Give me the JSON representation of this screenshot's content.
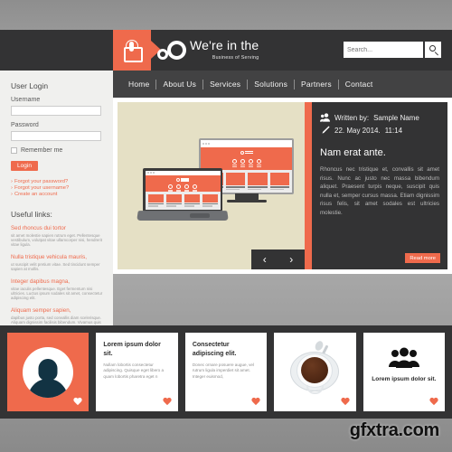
{
  "header": {
    "brand_line1": "We're in the",
    "brand_line2": "Business of Serving",
    "search_placeholder": "Search...",
    "search_value": ""
  },
  "nav": {
    "items": [
      {
        "label": "Home"
      },
      {
        "label": "About Us"
      },
      {
        "label": "Services"
      },
      {
        "label": "Solutions"
      },
      {
        "label": "Partners"
      },
      {
        "label": "Contact"
      }
    ]
  },
  "sidebar": {
    "login_title": "User Login",
    "username_label": "Username",
    "username_value": "",
    "password_label": "Password",
    "password_value": "",
    "remember_label": "Remember me",
    "login_button": "Login",
    "forgot_password": "Forgot your password?",
    "forgot_username": "Forgot your username?",
    "create_account": "Create an account",
    "useful_links_title": "Useful links:",
    "links": [
      {
        "title": "Sed rhoncus dui tortor",
        "body": "sit amet molestie sapien rutrum eget. Pellentesque vestibulum, volutpat vitae ullamcorper nisi, hendrerit vitae ligula."
      },
      {
        "title": "Nulla tristique vehicula mauris,",
        "body": "ut suscipit velit pretium vitae. Sed tincidunt semper sapien at mollis."
      },
      {
        "title": "Integer dapibus magna,",
        "body": "vitae iaculis pellentesque. Eget fermentum nisi ultricies. Luctus ipsum sodales sit amet, consectetur adipiscing elit."
      },
      {
        "title": "Aliquam semper sapien,",
        "body": "dapibus justo porta, sed convallis diam scelerisque. Aliquam dignissim facilisis bibendum. Vivamus quis dui erat."
      }
    ]
  },
  "hero": {
    "prev_arrow": "‹",
    "next_arrow": "›",
    "article": {
      "author_prefix": "Written by:",
      "author_name": "Sample Name",
      "date": "22. May 2014.",
      "time": "11:14",
      "title": "Nam erat ante.",
      "body": "Rhoncus nec tristique et, convallis sit amet risus. Nunc ac justo nec massa bibendum aliquet. Praesent turpis neque, suscipit quis nulla et, semper cursus massa. Etiam dignissim risus felis, sit amet sodales est ultricies molestie.",
      "read_more": "Read more"
    }
  },
  "cards": [
    {
      "type": "avatar",
      "title": "",
      "body": ""
    },
    {
      "type": "text",
      "title": "Lorem ipsum dolor sit.",
      "body": "Nullam lobortis consectetur adipiscing. Quisque eget libero a quam lobortis pharetra eget n"
    },
    {
      "type": "text",
      "title": "Consectetur adipiscing elit.",
      "body": "Donec ornare posuere augue, vel rutrum ligula imperdiet sit amet. Integer euismod,"
    },
    {
      "type": "coffee",
      "title": "",
      "body": ""
    },
    {
      "type": "group",
      "title": "Lorem ipsum dolor sit.",
      "body": ""
    }
  ],
  "watermark": "gfxtra.com",
  "colors": {
    "accent": "#ef6a4c",
    "dark": "#333334",
    "nav": "#424243",
    "sidebar": "#f0f0ee",
    "slide_bg": "#e5e0c5"
  }
}
